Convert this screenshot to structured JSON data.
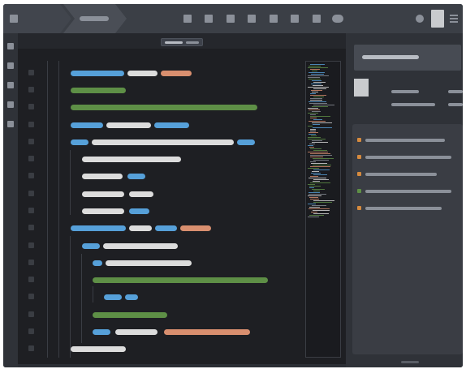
{
  "theme": {
    "window_bg": "#2b2e34",
    "editor_bg": "#1e1f23",
    "token_blue": "#56a0d9",
    "token_white": "#dcdcdc",
    "token_orange": "#d98f6f",
    "token_green": "#5e8f46"
  },
  "icons": {
    "top_toolbar": [
      "toolbar-icon",
      "toolbar-icon",
      "toolbar-icon",
      "toolbar-icon",
      "toolbar-icon",
      "toolbar-icon",
      "toolbar-icon",
      "toolbar-icon",
      "toolbar-toggle-icon"
    ],
    "rail": [
      "rail-icon",
      "rail-icon",
      "rail-icon",
      "rail-icon",
      "rail-icon"
    ],
    "menu": "hamburger-menu-icon"
  },
  "editor": {
    "line_count": 17
  },
  "right_panel": {
    "list_markers": [
      "orange",
      "orange",
      "orange",
      "green",
      "orange"
    ]
  }
}
